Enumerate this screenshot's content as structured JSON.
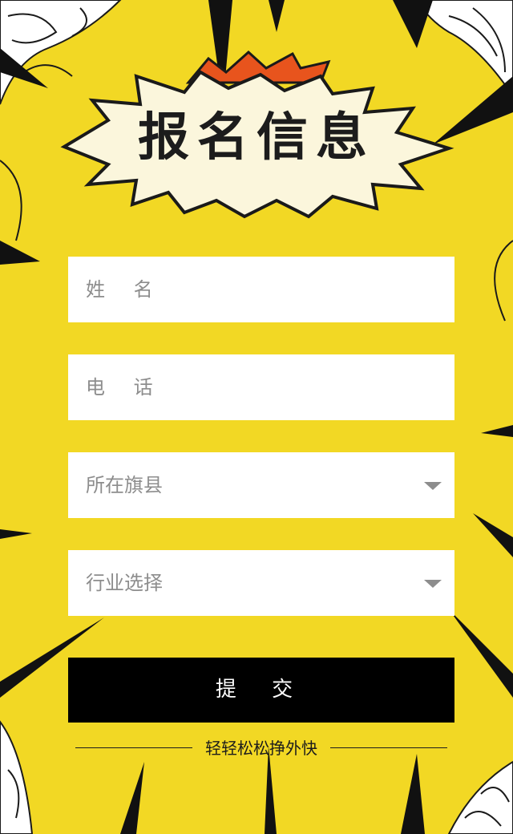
{
  "page": {
    "title": "报名信息",
    "background_color": "#f2d824",
    "accent_orange": "#e8541d"
  },
  "form": {
    "name_placeholder": "姓 名",
    "phone_placeholder": "电 话",
    "county_select": {
      "label": "所在旗县",
      "icon": "chevron-down-icon"
    },
    "industry_select": {
      "label": "行业选择",
      "icon": "chevron-down-icon"
    },
    "submit_label": "提 交"
  },
  "footer": {
    "tagline": "轻轻松松挣外快"
  }
}
